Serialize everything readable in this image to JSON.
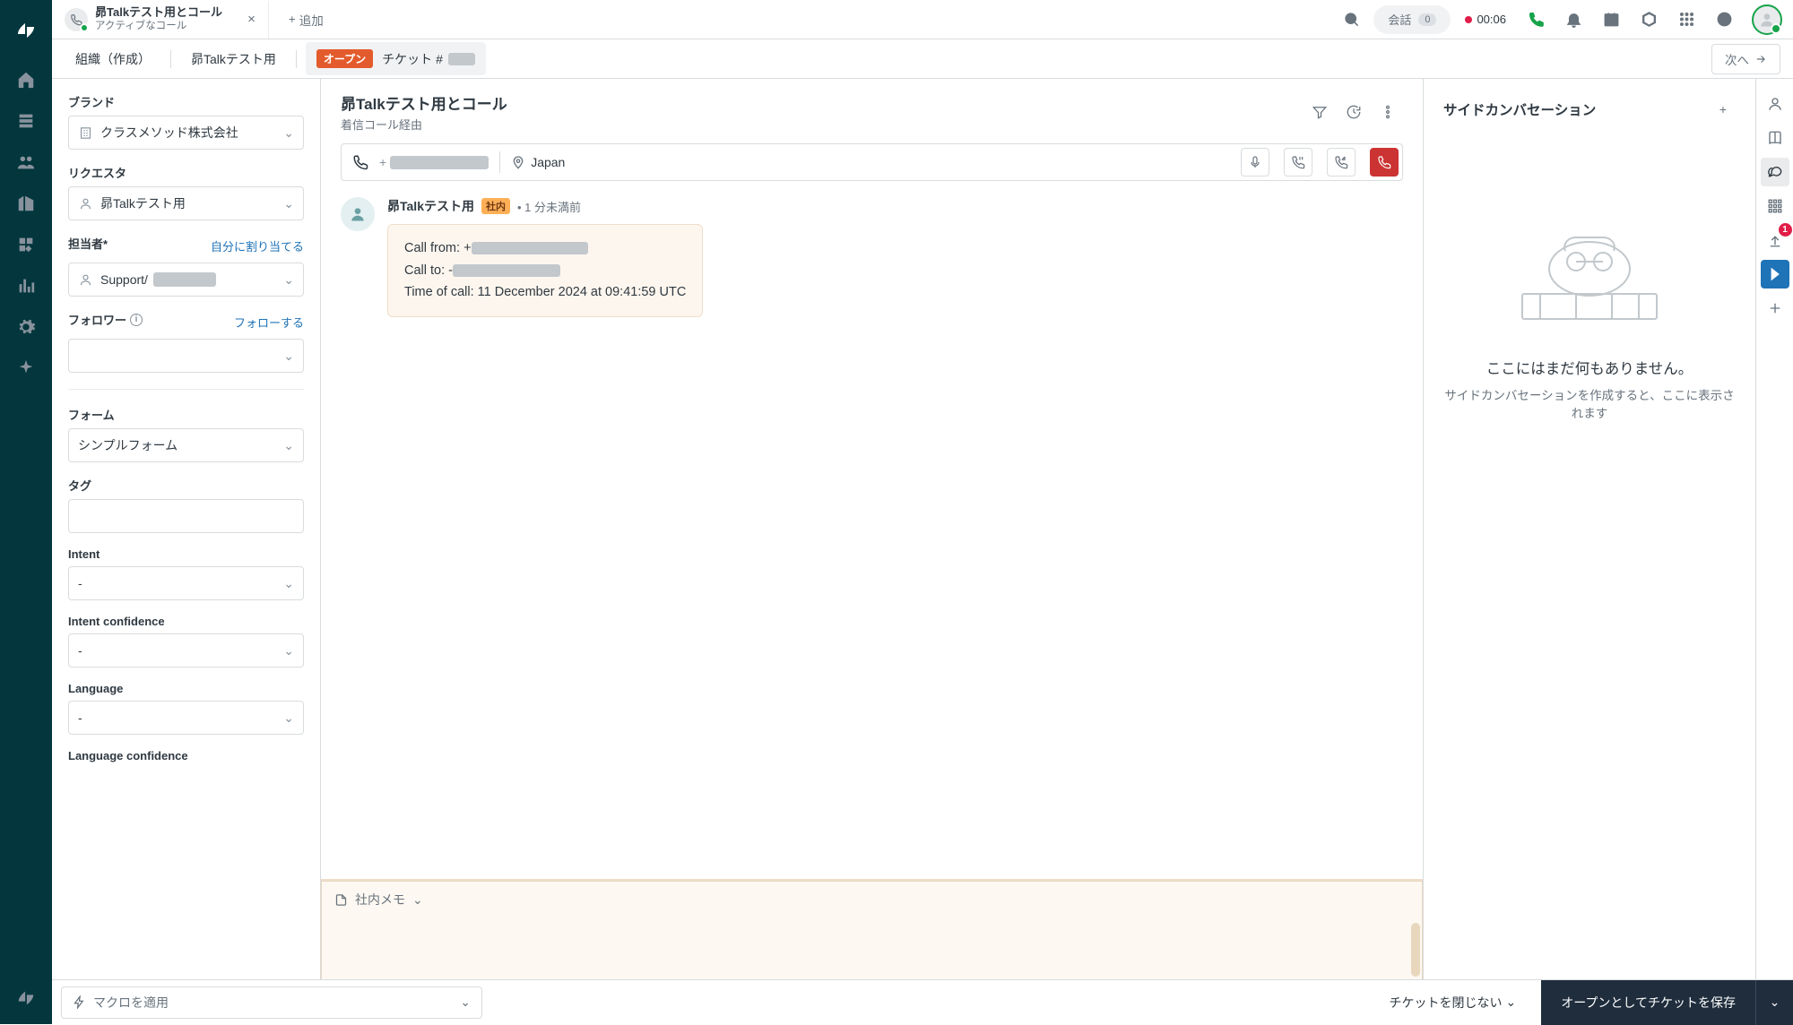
{
  "topbar": {
    "tab_title": "昴Talkテスト用とコール",
    "tab_subtitle": "アクティブなコール",
    "add_tab": "追加",
    "conversation_label": "会話",
    "conversation_count": "0",
    "rec_time": "00:06"
  },
  "crumbs": {
    "org": "組織（作成）",
    "requester": "昴Talkテスト用",
    "status": "オープン",
    "ticket_prefix": "チケット #",
    "next": "次へ"
  },
  "sidebar": {
    "brand_label": "ブランド",
    "brand_value": "クラスメソッド株式会社",
    "requester_label": "リクエスタ",
    "requester_value": "昴Talkテスト用",
    "assignee_label": "担当者*",
    "assignee_action": "自分に割り当てる",
    "assignee_value_prefix": "Support/",
    "follower_label": "フォロワー",
    "follower_action": "フォローする",
    "form_label": "フォーム",
    "form_value": "シンプルフォーム",
    "tags_label": "タグ",
    "intent_label": "Intent",
    "intent_value": "-",
    "intent_conf_label": "Intent confidence",
    "intent_conf_value": "-",
    "lang_label": "Language",
    "lang_value": "-",
    "lang_conf_label": "Language confidence"
  },
  "ticket": {
    "title": "昴Talkテスト用とコール",
    "subtitle": "着信コール経由",
    "location": "Japan",
    "msg_name": "昴Talkテスト用",
    "msg_pill": "社内",
    "msg_time": "1 分未満前",
    "call_from_label": "Call from: ",
    "call_from_prefix": "+",
    "call_to_label": "Call to: ",
    "call_to_prefix": "-",
    "call_time": "Time of call: 11 December 2024 at 09:41:59 UTC",
    "composer_mode": "社内メモ"
  },
  "side": {
    "title": "サイドカンバセーション",
    "empty_h": "ここにはまだ何もありません。",
    "empty_s": "サイドカンバセーションを作成すると、ここに表示されます"
  },
  "footer": {
    "macro": "マクロを適用",
    "close": "チケットを閉じない",
    "save": "オープンとしてチケットを保存"
  },
  "right_rail_badge": "1"
}
